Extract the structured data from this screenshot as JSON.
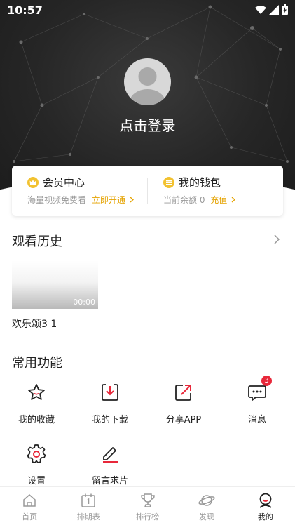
{
  "status_bar": {
    "time": "10:57"
  },
  "profile": {
    "login_text": "点击登录"
  },
  "vip_card": {
    "member": {
      "title": "会员中心",
      "subtitle": "海量视频免费看",
      "action": "立即开通"
    },
    "wallet": {
      "title": "我的钱包",
      "subtitle": "当前余额 0",
      "action": "充值"
    }
  },
  "history": {
    "title": "观看历史",
    "items": [
      {
        "title": "欢乐颂3 1",
        "duration": "00:00"
      }
    ]
  },
  "functions": {
    "title": "常用功能",
    "items": [
      {
        "label": "我的收藏",
        "icon": "star-icon"
      },
      {
        "label": "我的下载",
        "icon": "download-icon"
      },
      {
        "label": "分享APP",
        "icon": "share-icon"
      },
      {
        "label": "消息",
        "icon": "message-icon",
        "badge": "3"
      },
      {
        "label": "设置",
        "icon": "gear-icon"
      },
      {
        "label": "留言求片",
        "icon": "edit-icon"
      }
    ]
  },
  "tabbar": {
    "items": [
      {
        "label": "首页",
        "icon": "home-icon"
      },
      {
        "label": "排期表",
        "icon": "calendar-icon"
      },
      {
        "label": "排行榜",
        "icon": "trophy-icon"
      },
      {
        "label": "发现",
        "icon": "planet-icon"
      },
      {
        "label": "我的",
        "icon": "profile-icon",
        "active": true
      }
    ]
  },
  "colors": {
    "accent": "#e8283a",
    "gold": "#e5a300",
    "header_bg": "#262626"
  }
}
